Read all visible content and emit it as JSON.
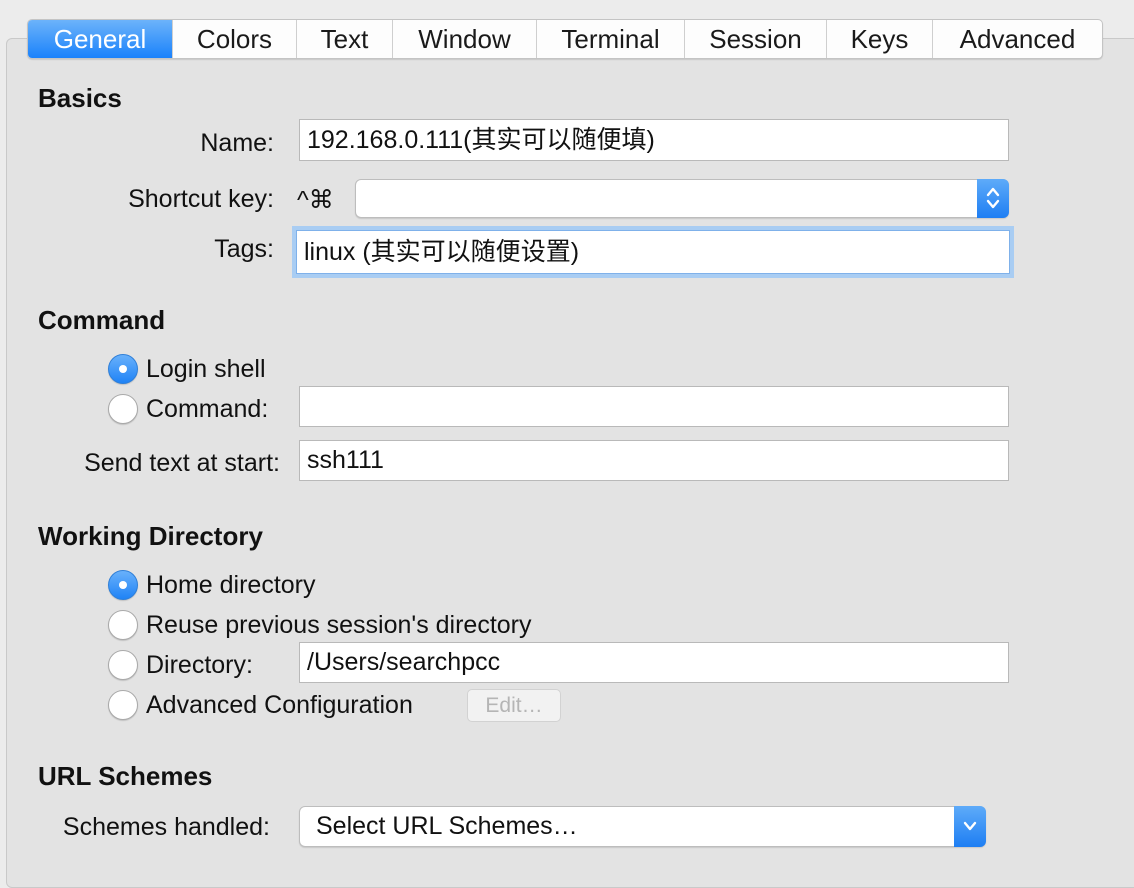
{
  "tabs": [
    "General",
    "Colors",
    "Text",
    "Window",
    "Terminal",
    "Session",
    "Keys",
    "Advanced"
  ],
  "active_tab": "General",
  "basics": {
    "title": "Basics",
    "name_label": "Name:",
    "name_value": "192.168.0.111(其实可以随便填)",
    "shortcut_label": "Shortcut key:",
    "shortcut_prefix": "^⌘",
    "shortcut_value": "",
    "tags_label": "Tags:",
    "tags_value": "linux (其实可以随便设置)"
  },
  "command": {
    "title": "Command",
    "login_shell_label": "Login shell",
    "login_shell_selected": true,
    "command_label": "Command:",
    "command_value": "",
    "send_text_label": "Send text at start:",
    "send_text_value": "ssh111"
  },
  "working_directory": {
    "title": "Working Directory",
    "home_label": "Home directory",
    "reuse_label": "Reuse previous session's directory",
    "directory_label": "Directory:",
    "directory_value": "/Users/searchpcc",
    "advanced_label": "Advanced Configuration",
    "edit_button": "Edit…",
    "selected": "Home directory"
  },
  "url_schemes": {
    "title": "URL Schemes",
    "schemes_label": "Schemes handled:",
    "schemes_value": "Select URL Schemes…"
  },
  "colors": {
    "accent": "#1a82fb",
    "panel_bg": "#e3e3e3",
    "focus_ring": "#a9cdf3"
  },
  "icons": {
    "popup_stepper": "up-down-chevron-icon",
    "popup_dropdown": "chevron-down-icon"
  }
}
